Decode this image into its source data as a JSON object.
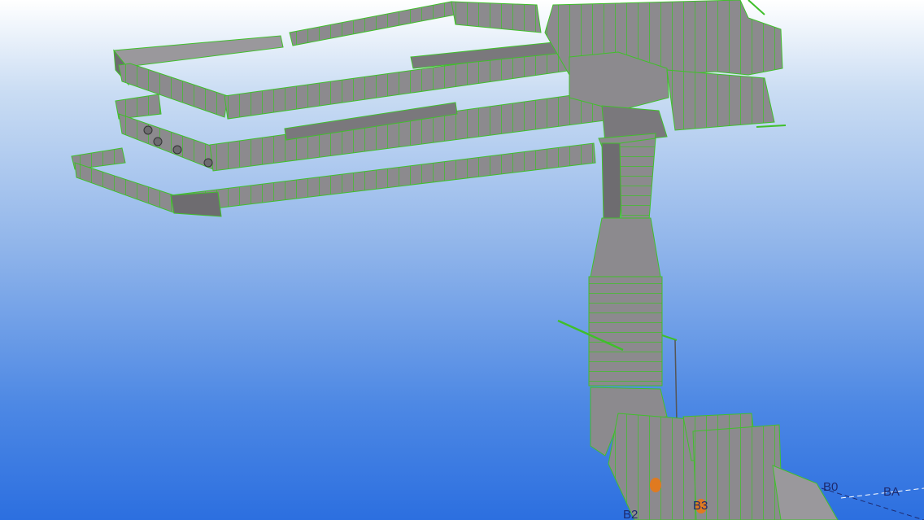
{
  "viewport": {
    "background_top": "#ffffff",
    "background_bottom": "#2c6fe0",
    "duct_face_color": "#8c8a8e",
    "duct_shadow_color": "#6e6c70",
    "seam_color": "#3fbf2a",
    "fitting_color": "#e07a20"
  },
  "grid_labels": {
    "b0": "B0",
    "ba": "BA",
    "b2": "B2",
    "b3": "B3"
  },
  "icons": [
    "duct-run",
    "vertical-shaft",
    "end-cap-flange"
  ]
}
